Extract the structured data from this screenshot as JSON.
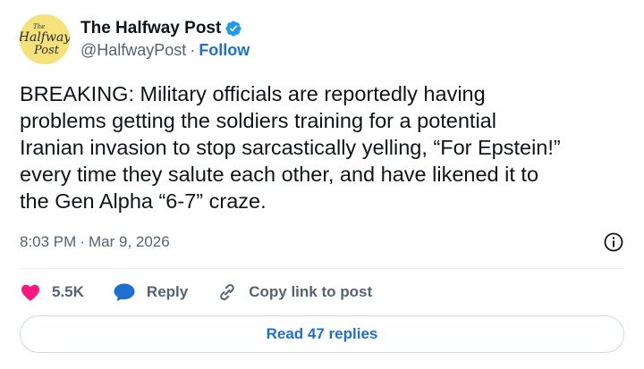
{
  "author": {
    "display_name": "The Halfway Post",
    "handle": "@HalfwayPost",
    "separator": "·",
    "follow_label": "Follow",
    "avatar_text": "The Halfway Post",
    "avatar_bg": "#f6e27a",
    "verified_color": "#1d9bf0"
  },
  "post": {
    "text": "BREAKING: Military officials are reportedly having\nproblems getting the soldiers training for a potential\nIranian invasion to stop sarcastically yelling, “For Epstein!”\nevery time they salute each other, and have likened it to\nthe Gen Alpha “6-7” craze.",
    "time": "8:03 PM",
    "separator": "·",
    "date": "Mar 9, 2026"
  },
  "actions": {
    "like_count": "5.5K",
    "reply_label": "Reply",
    "copy_link_label": "Copy link to post",
    "like_color": "#f91880",
    "reply_color": "#1d6fd1"
  },
  "replies": {
    "read_label": "Read 47 replies"
  },
  "icons": {
    "verified": "verified-badge-icon",
    "info": "info-icon",
    "like": "heart-icon",
    "reply": "speech-bubble-icon",
    "copy_link": "link-icon"
  }
}
